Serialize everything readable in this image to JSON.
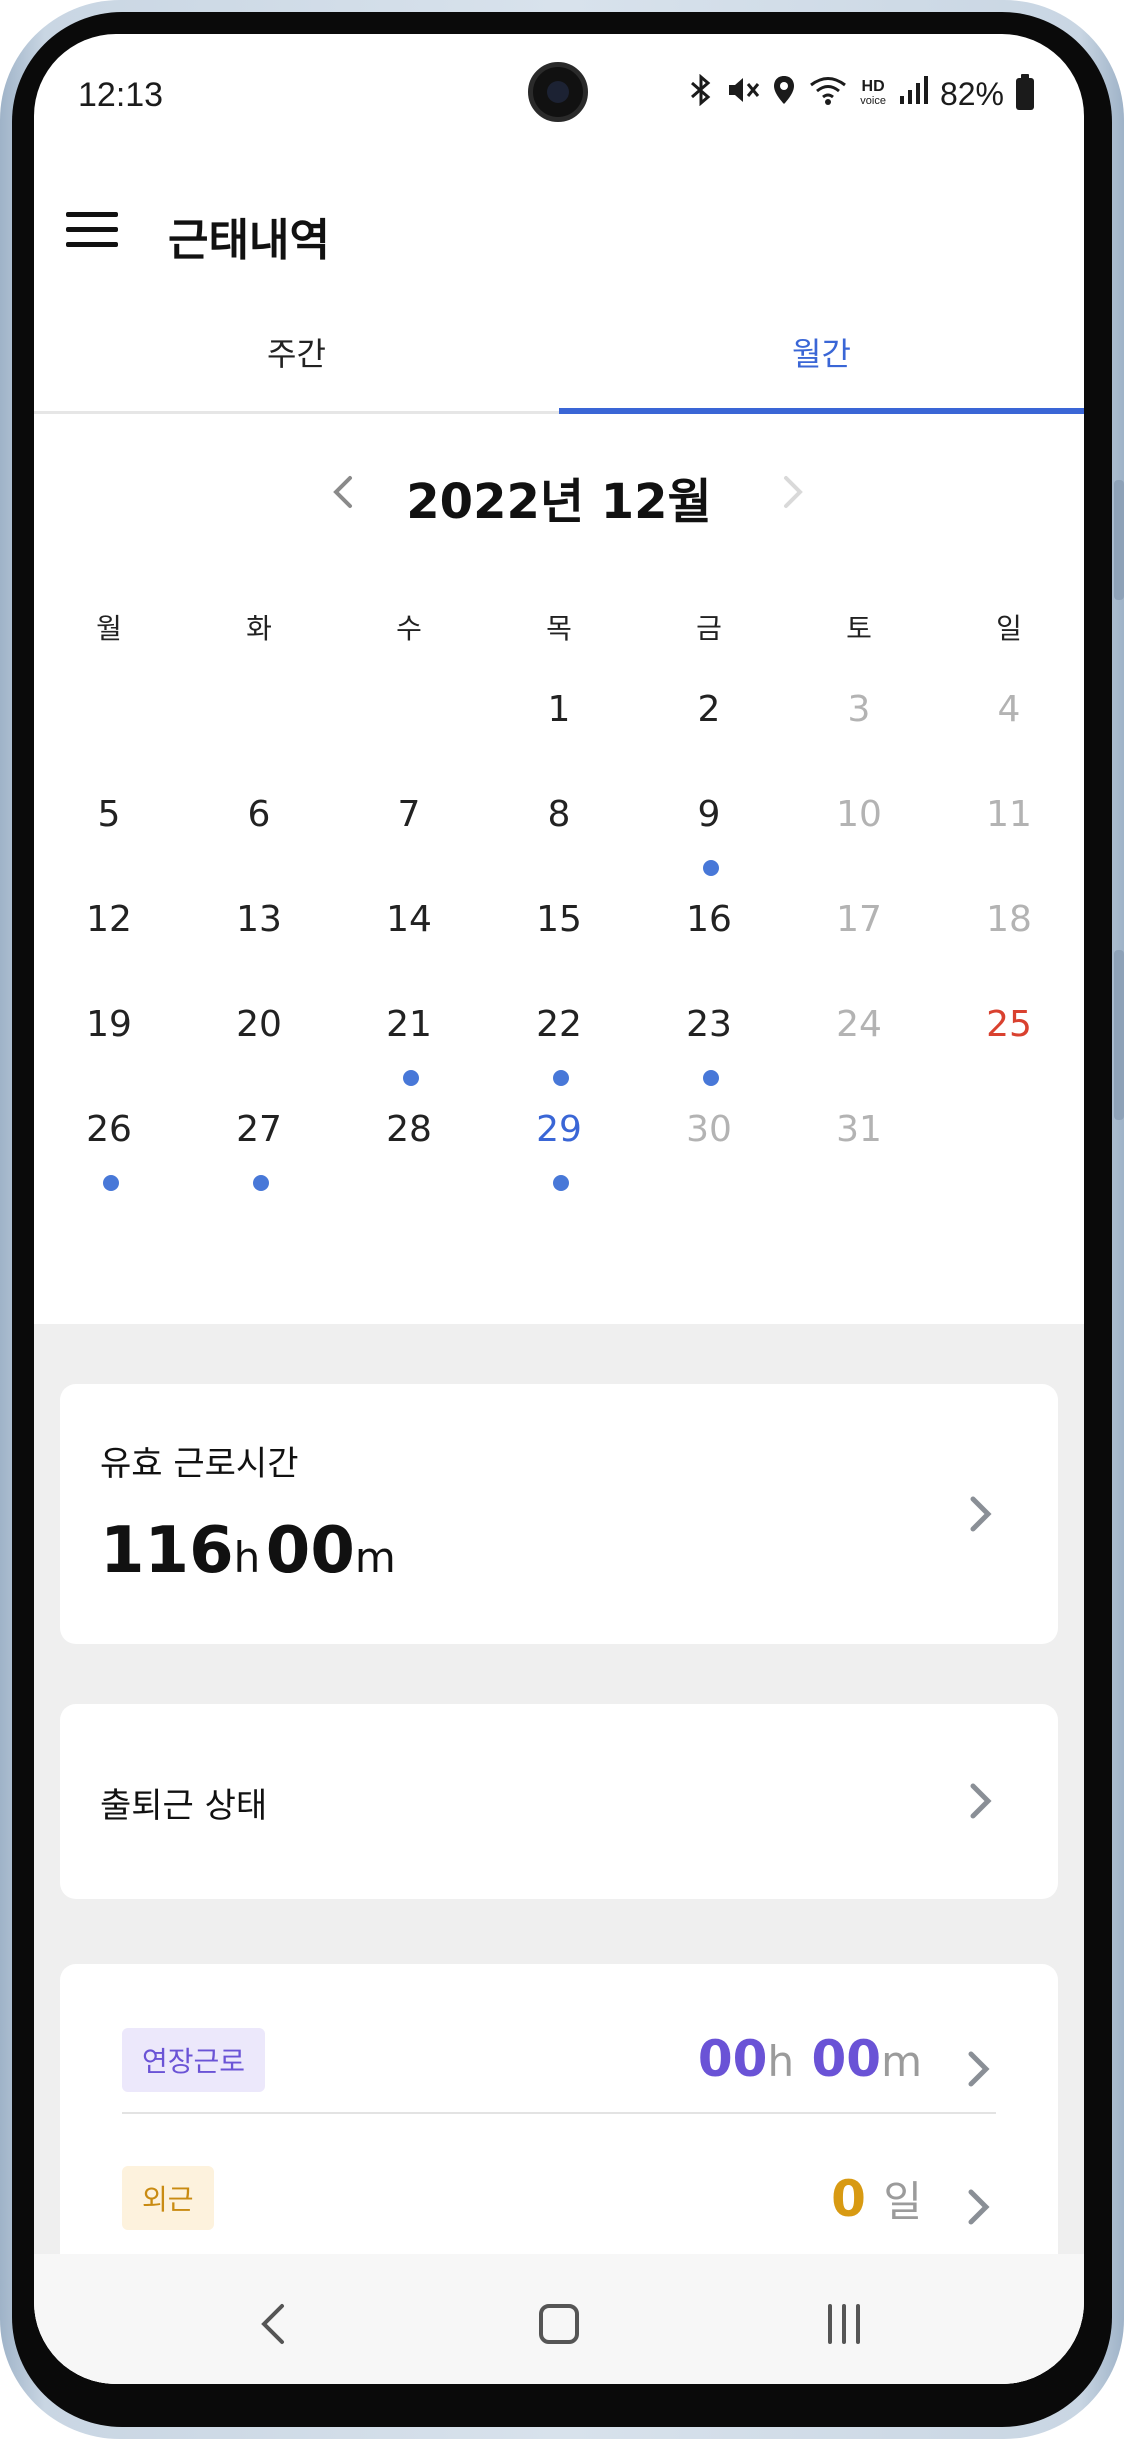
{
  "status_bar": {
    "time": "12:13",
    "hd_label_1": "HD",
    "hd_label_2": "voice",
    "battery": "82%"
  },
  "app_bar": {
    "title": "근태내역",
    "menu_icon": "hamburger-menu-icon"
  },
  "tabs": [
    {
      "label": "주간",
      "active": false
    },
    {
      "label": "월간",
      "active": true
    }
  ],
  "calendar": {
    "month_title": "2022년 12월",
    "weekdays": [
      "월",
      "화",
      "수",
      "목",
      "금",
      "토",
      "일"
    ],
    "weeks": [
      [
        {
          "d": ""
        },
        {
          "d": ""
        },
        {
          "d": ""
        },
        {
          "d": "1"
        },
        {
          "d": "2"
        },
        {
          "d": "3",
          "s": "weekend"
        },
        {
          "d": "4",
          "s": "weekend"
        }
      ],
      [
        {
          "d": "5"
        },
        {
          "d": "6"
        },
        {
          "d": "7"
        },
        {
          "d": "8"
        },
        {
          "d": "9",
          "dot": true
        },
        {
          "d": "10",
          "s": "weekend"
        },
        {
          "d": "11",
          "s": "weekend"
        }
      ],
      [
        {
          "d": "12"
        },
        {
          "d": "13"
        },
        {
          "d": "14"
        },
        {
          "d": "15"
        },
        {
          "d": "16"
        },
        {
          "d": "17",
          "s": "weekend"
        },
        {
          "d": "18",
          "s": "weekend"
        }
      ],
      [
        {
          "d": "19"
        },
        {
          "d": "20"
        },
        {
          "d": "21",
          "dot": true
        },
        {
          "d": "22",
          "dot": true
        },
        {
          "d": "23",
          "dot": true
        },
        {
          "d": "24",
          "s": "weekend"
        },
        {
          "d": "25",
          "s": "holiday"
        }
      ],
      [
        {
          "d": "26",
          "dot": true
        },
        {
          "d": "27",
          "dot": true
        },
        {
          "d": "28"
        },
        {
          "d": "29",
          "dot": true,
          "s": "today"
        },
        {
          "d": "30",
          "s": "future"
        },
        {
          "d": "31",
          "s": "future"
        },
        {
          "d": ""
        }
      ]
    ]
  },
  "paid_work_time": {
    "label": "유효 근로시간",
    "hours": "116",
    "hours_unit": "h",
    "minutes": "00",
    "minutes_unit": "m"
  },
  "commute_status": {
    "label": "출퇴근 상태"
  },
  "extra_work": {
    "overtime_label": "연장근로",
    "overtime_hours": "00",
    "overtime_hours_unit": "h",
    "overtime_minutes": "00",
    "overtime_minutes_unit": "m",
    "outside_label": "외근",
    "outside_days": "0",
    "outside_days_unit": "일"
  },
  "colors": {
    "accent": "#3a66d6",
    "dot": "#4878d8",
    "holiday": "#d9412f",
    "overtime": "#6a53d6",
    "outside": "#d89a12"
  }
}
